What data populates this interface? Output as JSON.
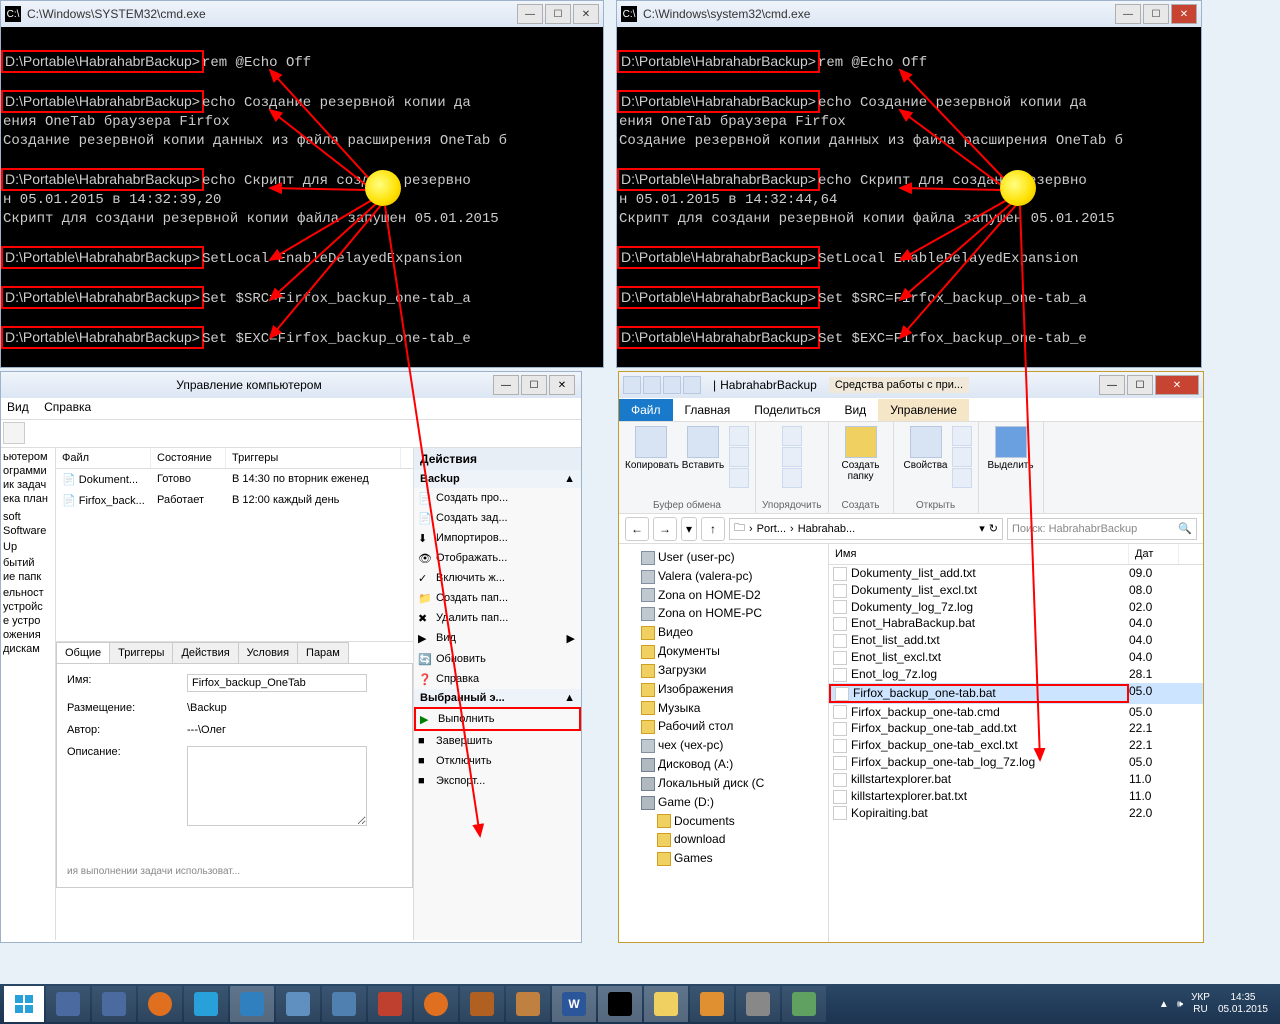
{
  "cmd": {
    "title_left": "C:\\Windows\\SYSTEM32\\cmd.exe",
    "title_right": "C:\\Windows\\system32\\cmd.exe",
    "prompt": "D:\\Portable\\HabrahabrBackup>",
    "l1_cmd": "rem @Echo Off",
    "l2_cmd": "echo Создание резервной копии да",
    "l2b": "ения OneTab браузера Firfox",
    "l2c": "Создание резервной копии данных из файла расширения OneTab б",
    "l3_cmd_l": "echo Скрипт для создани резервно",
    "l3_cmd_r": "echo Скрипт для создани резервно",
    "l3b_l": "н 05.01.2015 в 14:32:39,20",
    "l3b_r": "н 05.01.2015 в 14:32:44,64",
    "l3c": "Скрипт для создани резервной копии файла запушен 05.01.2015",
    "l4_cmd": "SetLocal EnableDelayedExpansion",
    "l5_cmd": "Set $SRC=Firfox_backup_one-tab_a",
    "l6_cmd": "Set $EXC=Firfox_backup_one-tab_e"
  },
  "mgmt": {
    "title": "Управление компьютером",
    "menu_view": "Вид",
    "menu_help": "Справка",
    "tree": [
      "ьютером",
      "ограмми",
      "ик задач",
      "ека план",
      "",
      "",
      "soft",
      "Software",
      "",
      "Up",
      "",
      "бытий",
      "ие папк",
      "",
      "ельност",
      "устройс",
      "е устро",
      "ожения",
      "дискам"
    ],
    "cols": {
      "file": "Файл",
      "state": "Состояние",
      "trig": "Триггеры"
    },
    "rows": [
      {
        "file": "Dokument...",
        "state": "Готово",
        "trig": "В 14:30 по вторник еженед"
      },
      {
        "file": "Firfox_back...",
        "state": "Работает",
        "trig": "В 12:00 каждый день"
      }
    ],
    "tabs": {
      "general": "Общие",
      "triggers": "Триггеры",
      "actions": "Действия",
      "cond": "Условия",
      "param": "Парам"
    },
    "props": {
      "name_lbl": "Имя:",
      "name_val": "Firfox_backup_OneTab",
      "loc_lbl": "Размещение:",
      "loc_val": "\\Backup",
      "author_lbl": "Автор:",
      "author_val": "---\\Олег",
      "desc_lbl": "Описание:"
    },
    "actions": {
      "header": "Действия",
      "sect1": "Backup",
      "items1": [
        "Создать про...",
        "Создать зад...",
        "Импортиров...",
        "Отображать...",
        "Включить ж...",
        "Создать пап...",
        "Удалить пап...",
        "Вид",
        "Обновить",
        "Справка"
      ],
      "sect2": "Выбранный э...",
      "run": "Выполнить",
      "items2": [
        "Завершить",
        "Отключить",
        "Экспорт..."
      ]
    },
    "footer": "ия выполнении задачи использоват..."
  },
  "expl": {
    "title": "HabrahabrBackup",
    "tooltab": "Средства работы с при...",
    "rtabs": {
      "file": "Файл",
      "home": "Главная",
      "share": "Поделиться",
      "view": "Вид",
      "manage": "Управление"
    },
    "ribbon": {
      "copy": "Копировать",
      "paste": "Вставить",
      "clip_grp": "Буфер обмена",
      "org_grp": "Упорядочить",
      "newf": "Создать\nпапку",
      "new_grp": "Создать",
      "props": "Свойства",
      "open_grp": "Открыть",
      "select": "Выделить"
    },
    "crumb": {
      "p1": "Port...",
      "p2": "Habrahab..."
    },
    "search_ph": "Поиск: HabrahabrBackup",
    "cols": {
      "name": "Имя",
      "date": "Дат"
    },
    "tree": [
      "User (user-pc)",
      "Valera (valera-pc)",
      "Zona on HOME-D2",
      "Zona on HOME-PC",
      "Видео",
      "Документы",
      "Загрузки",
      "Изображения",
      "Музыка",
      "Рабочий стол",
      "чех (чех-pc)",
      "Дисковод (A:)",
      "Локальный диск (C",
      "Game (D:)",
      "Documents",
      "download",
      "Games"
    ],
    "files": [
      {
        "n": "Dokumenty_list_add.txt",
        "d": "09.0"
      },
      {
        "n": "Dokumenty_list_excl.txt",
        "d": "08.0"
      },
      {
        "n": "Dokumenty_log_7z.log",
        "d": "02.0"
      },
      {
        "n": "Enot_HabraBackup.bat",
        "d": "04.0"
      },
      {
        "n": "Enot_list_add.txt",
        "d": "04.0"
      },
      {
        "n": "Enot_list_excl.txt",
        "d": "04.0"
      },
      {
        "n": "Enot_log_7z.log",
        "d": "28.1"
      },
      {
        "n": "Firfox_backup_one-tab.bat",
        "d": "05.0",
        "sel": true
      },
      {
        "n": "Firfox_backup_one-tab.cmd",
        "d": "05.0"
      },
      {
        "n": "Firfox_backup_one-tab_add.txt",
        "d": "22.1"
      },
      {
        "n": "Firfox_backup_one-tab_excl.txt",
        "d": "22.1"
      },
      {
        "n": "Firfox_backup_one-tab_log_7z.log",
        "d": "05.0"
      },
      {
        "n": "killstartexplorer.bat",
        "d": "11.0"
      },
      {
        "n": "killstartexplorer.bat.txt",
        "d": "11.0"
      },
      {
        "n": "Kopiraiting.bat",
        "d": "22.0"
      }
    ]
  },
  "tray": {
    "lang": "УКР",
    "lang2": "RU",
    "time": "14:35",
    "date": "05.01.2015"
  }
}
